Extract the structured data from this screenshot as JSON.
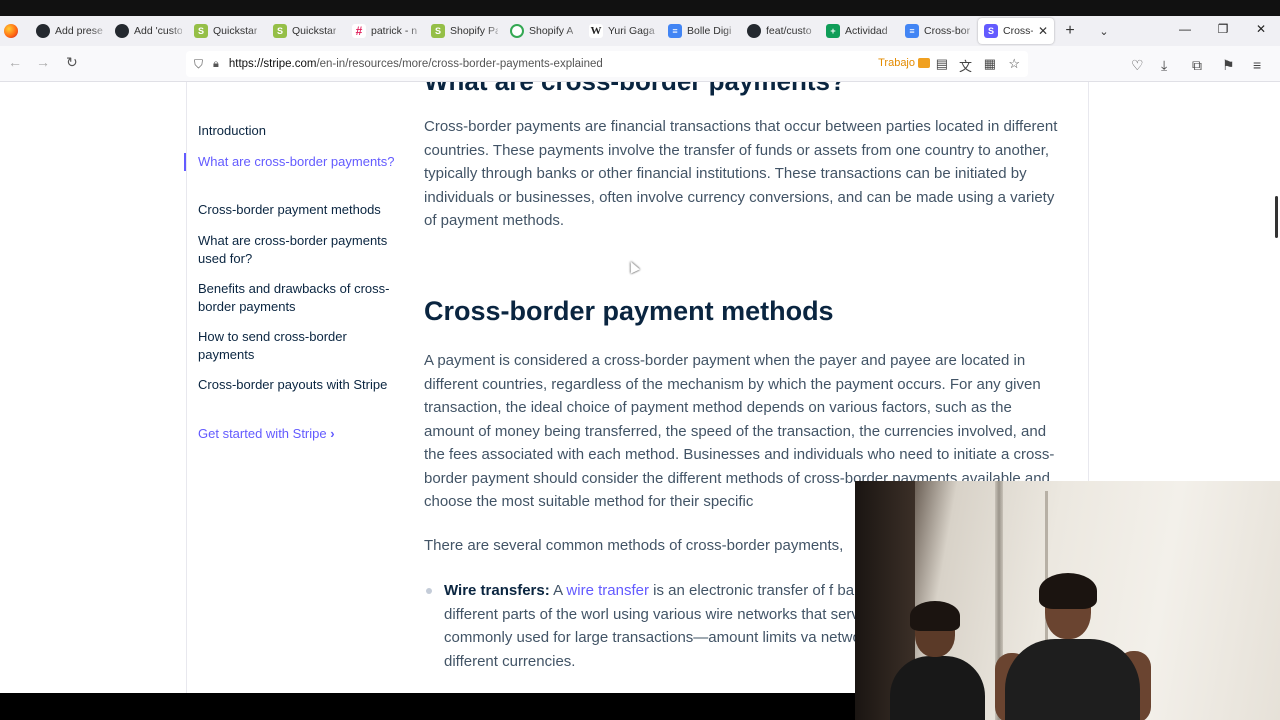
{
  "tabs": [
    {
      "icon": "github-icon",
      "cls": "gh",
      "glyph": "",
      "label": "Add prese"
    },
    {
      "icon": "github-icon",
      "cls": "gh",
      "glyph": "",
      "label": "Add 'custo"
    },
    {
      "icon": "shopify-icon",
      "cls": "shop",
      "glyph": "S",
      "label": "Quickstar"
    },
    {
      "icon": "shopify-icon",
      "cls": "shop",
      "glyph": "S",
      "label": "Quickstar"
    },
    {
      "icon": "slack-icon",
      "cls": "slack",
      "glyph": "#",
      "label": "patrick - n"
    },
    {
      "icon": "shopify-icon",
      "cls": "shop",
      "glyph": "S",
      "label": "Shopify Pa"
    },
    {
      "icon": "chatgpt-icon",
      "cls": "cg",
      "glyph": "",
      "label": "Shopify A"
    },
    {
      "icon": "wikipedia-icon",
      "cls": "w",
      "glyph": "W",
      "label": "Yuri Gaga"
    },
    {
      "icon": "google-docs-icon",
      "cls": "doc",
      "glyph": "≡",
      "label": "Bolle Digi"
    },
    {
      "icon": "github-icon",
      "cls": "gh",
      "glyph": "",
      "label": "feat/custo"
    },
    {
      "icon": "google-sheets-icon",
      "cls": "sheet",
      "glyph": "+",
      "label": "Actividad"
    },
    {
      "icon": "google-docs-icon",
      "cls": "doc",
      "glyph": "≡",
      "label": "Cross-bor"
    },
    {
      "icon": "stripe-icon",
      "cls": "stripe",
      "glyph": "S",
      "label": "Cross-b",
      "active": true
    }
  ],
  "browser": {
    "url_host": "https://stripe.com",
    "url_path": "/en-in/resources/more/cross-border-payments-explained",
    "container_label": "Trabajo"
  },
  "toc": {
    "items": [
      {
        "label": "Introduction",
        "active": false
      },
      {
        "label": "What are cross-border payments?",
        "active": true
      },
      {
        "label": "Cross-border payment methods",
        "active": false
      },
      {
        "label": "What are cross-border payments used for?",
        "active": false
      },
      {
        "label": "Benefits and drawbacks of cross-border payments",
        "active": false
      },
      {
        "label": "How to send cross-border payments",
        "active": false
      },
      {
        "label": "Cross-border payouts with Stripe",
        "active": false
      }
    ],
    "cta_label": "Get started with Stripe",
    "cta_chevron": "›"
  },
  "article": {
    "prev_heading": "What are cross-border payments?",
    "para1": "Cross-border payments are financial transactions that occur between parties located in different countries. These payments involve the transfer of funds or assets from one country to another, typically through banks or other financial institutions. These transactions can be initiated by individuals or businesses, often involve currency conversions, and can be made using a variety of payment methods.",
    "heading": "Cross-border payment methods",
    "para2": "A payment is considered a cross-border payment when the payer and payee are located in different countries, regardless of the mechanism by which the payment occurs. For any given transaction, the ideal choice of payment method depends on various factors, such as the amount of money being transferred, the speed of the transaction, the currencies involved, and the fees associated with each method. Businesses and individuals who need to initiate a cross-border payment should consider the different methods of cross-border payments available and choose the most suitable method for their specific",
    "para3": "There are several common methods of cross-border payments,",
    "bullet_title": "Wire transfers:",
    "bullet_pre": " A ",
    "bullet_link": "wire transfer",
    "bullet_text": " is an electronic transfer of f banks or financial institutions. In different parts of the worl using various wire networks that service different geograp is commonly used for large transactions—amount limits va network—and can be sent in different currencies."
  }
}
